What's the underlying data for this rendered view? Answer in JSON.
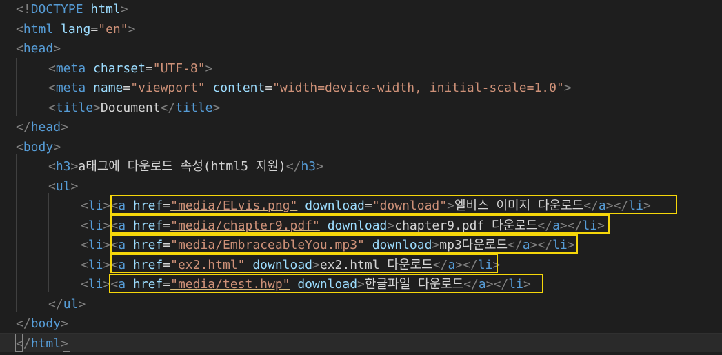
{
  "editor": {
    "language": "html",
    "lines": [
      {
        "tokens": [
          [
            "t",
            "<!"
          ],
          [
            "n",
            "DOCTYPE"
          ],
          [
            "t",
            " "
          ],
          [
            "at",
            "html"
          ],
          [
            "t",
            ">"
          ]
        ]
      },
      {
        "tokens": [
          [
            "t",
            "<"
          ],
          [
            "n",
            "html"
          ],
          [
            "t",
            " "
          ],
          [
            "at",
            "lang"
          ],
          [
            "tx",
            "="
          ],
          [
            "v",
            "\"en\""
          ],
          [
            "t",
            ">"
          ]
        ]
      },
      {
        "tokens": [
          [
            "t",
            "<"
          ],
          [
            "n",
            "head"
          ],
          [
            "t",
            ">"
          ]
        ]
      },
      {
        "tokens": [
          [
            "t",
            "<"
          ],
          [
            "n",
            "meta"
          ],
          [
            "t",
            " "
          ],
          [
            "at",
            "charset"
          ],
          [
            "tx",
            "="
          ],
          [
            "v",
            "\"UTF-8\""
          ],
          [
            "t",
            ">"
          ]
        ]
      },
      {
        "tokens": [
          [
            "t",
            "<"
          ],
          [
            "n",
            "meta"
          ],
          [
            "t",
            " "
          ],
          [
            "at",
            "name"
          ],
          [
            "tx",
            "="
          ],
          [
            "v",
            "\"viewport\""
          ],
          [
            "t",
            " "
          ],
          [
            "at",
            "content"
          ],
          [
            "tx",
            "="
          ],
          [
            "v",
            "\"width=device-width, initial-scale=1.0\""
          ],
          [
            "t",
            ">"
          ]
        ]
      },
      {
        "tokens": [
          [
            "t",
            "<"
          ],
          [
            "n",
            "title"
          ],
          [
            "t",
            ">"
          ],
          [
            "tx",
            "Document"
          ],
          [
            "t",
            "</"
          ],
          [
            "n",
            "title"
          ],
          [
            "t",
            ">"
          ]
        ]
      },
      {
        "tokens": [
          [
            "t",
            "</"
          ],
          [
            "n",
            "head"
          ],
          [
            "t",
            ">"
          ]
        ]
      },
      {
        "tokens": [
          [
            "t",
            "<"
          ],
          [
            "n",
            "body"
          ],
          [
            "t",
            ">"
          ]
        ]
      },
      {
        "tokens": [
          [
            "t",
            "<"
          ],
          [
            "n",
            "h3"
          ],
          [
            "t",
            ">"
          ],
          [
            "tx",
            "a태그에 다운로드 속성(html5 지원)"
          ],
          [
            "t",
            "</"
          ],
          [
            "n",
            "h3"
          ],
          [
            "t",
            ">"
          ]
        ]
      },
      {
        "tokens": [
          [
            "t",
            "<"
          ],
          [
            "n",
            "ul"
          ],
          [
            "t",
            ">"
          ]
        ]
      },
      {
        "tokens": [
          [
            "t",
            "<"
          ],
          [
            "n",
            "li"
          ],
          [
            "t",
            ">"
          ],
          [
            "t",
            "<"
          ],
          [
            "n",
            "a"
          ],
          [
            "t",
            " "
          ],
          [
            "at",
            "href"
          ],
          [
            "tx",
            "="
          ],
          [
            "v",
            "\"media/ELvis.png\""
          ],
          [
            "t",
            " "
          ],
          [
            "at",
            "download"
          ],
          [
            "tx",
            "="
          ],
          [
            "v",
            "\"download\""
          ],
          [
            "t",
            ">"
          ],
          [
            "tx",
            "엘비스 이미지 다운로드"
          ],
          [
            "t",
            "</"
          ],
          [
            "n",
            "a"
          ],
          [
            "t",
            ">"
          ],
          [
            "t",
            "</"
          ],
          [
            "n",
            "li"
          ],
          [
            "t",
            ">"
          ]
        ]
      },
      {
        "tokens": [
          [
            "t",
            "<"
          ],
          [
            "n",
            "li"
          ],
          [
            "t",
            ">"
          ],
          [
            "t",
            "<"
          ],
          [
            "n",
            "a"
          ],
          [
            "t",
            " "
          ],
          [
            "at",
            "href"
          ],
          [
            "tx",
            "="
          ],
          [
            "v",
            "\"media/chapter9.pdf\""
          ],
          [
            "t",
            " "
          ],
          [
            "at",
            "download"
          ],
          [
            "t",
            ">"
          ],
          [
            "tx",
            "chapter9.pdf 다운로드"
          ],
          [
            "t",
            "</"
          ],
          [
            "n",
            "a"
          ],
          [
            "t",
            ">"
          ],
          [
            "t",
            "</"
          ],
          [
            "n",
            "li"
          ],
          [
            "t",
            ">"
          ]
        ]
      },
      {
        "tokens": [
          [
            "t",
            "<"
          ],
          [
            "n",
            "li"
          ],
          [
            "t",
            ">"
          ],
          [
            "t",
            "<"
          ],
          [
            "n",
            "a"
          ],
          [
            "t",
            " "
          ],
          [
            "at",
            "href"
          ],
          [
            "tx",
            "="
          ],
          [
            "v",
            "\"media/EmbraceableYou.mp3\""
          ],
          [
            "t",
            " "
          ],
          [
            "at",
            "download"
          ],
          [
            "t",
            ">"
          ],
          [
            "tx",
            "mp3다운로드"
          ],
          [
            "t",
            "</"
          ],
          [
            "n",
            "a"
          ],
          [
            "t",
            ">"
          ],
          [
            "t",
            "</"
          ],
          [
            "n",
            "li"
          ],
          [
            "t",
            ">"
          ]
        ]
      },
      {
        "tokens": [
          [
            "t",
            "<"
          ],
          [
            "n",
            "li"
          ],
          [
            "t",
            ">"
          ],
          [
            "t",
            "<"
          ],
          [
            "n",
            "a"
          ],
          [
            "t",
            " "
          ],
          [
            "at",
            "href"
          ],
          [
            "tx",
            "="
          ],
          [
            "v",
            "\"ex2.html\""
          ],
          [
            "t",
            " "
          ],
          [
            "at",
            "download"
          ],
          [
            "t",
            ">"
          ],
          [
            "tx",
            "ex2.html 다운로드"
          ],
          [
            "t",
            "</"
          ],
          [
            "n",
            "a"
          ],
          [
            "t",
            ">"
          ],
          [
            "t",
            "</"
          ],
          [
            "n",
            "li"
          ],
          [
            "t",
            ">"
          ]
        ]
      },
      {
        "tokens": [
          [
            "t",
            "<"
          ],
          [
            "n",
            "li"
          ],
          [
            "t",
            ">"
          ],
          [
            "t",
            "<"
          ],
          [
            "n",
            "a"
          ],
          [
            "t",
            " "
          ],
          [
            "at",
            "href"
          ],
          [
            "tx",
            "="
          ],
          [
            "v",
            "\"media/test.hwp\""
          ],
          [
            "t",
            " "
          ],
          [
            "at",
            "download"
          ],
          [
            "t",
            ">"
          ],
          [
            "tx",
            "한글파일 다운로드"
          ],
          [
            "t",
            "</"
          ],
          [
            "n",
            "a"
          ],
          [
            "t",
            ">"
          ],
          [
            "t",
            "</"
          ],
          [
            "n",
            "li"
          ],
          [
            "t",
            ">"
          ]
        ]
      },
      {
        "tokens": [
          [
            "t",
            "</"
          ],
          [
            "n",
            "ul"
          ],
          [
            "t",
            ">"
          ]
        ]
      },
      {
        "tokens": [
          [
            "t",
            "</"
          ],
          [
            "n",
            "body"
          ],
          [
            "t",
            ">"
          ]
        ]
      },
      {
        "tokens": [
          [
            "t",
            "</"
          ],
          [
            "n",
            "html"
          ],
          [
            "t",
            ">"
          ]
        ]
      }
    ],
    "highlight_color": "#f5d60a",
    "theme": {
      "background": "#1e1e1e",
      "tag": "#569cd6",
      "attribute": "#9cdcfe",
      "string": "#ce9178",
      "text": "#d4d4d4",
      "punctuation": "#808080"
    }
  }
}
